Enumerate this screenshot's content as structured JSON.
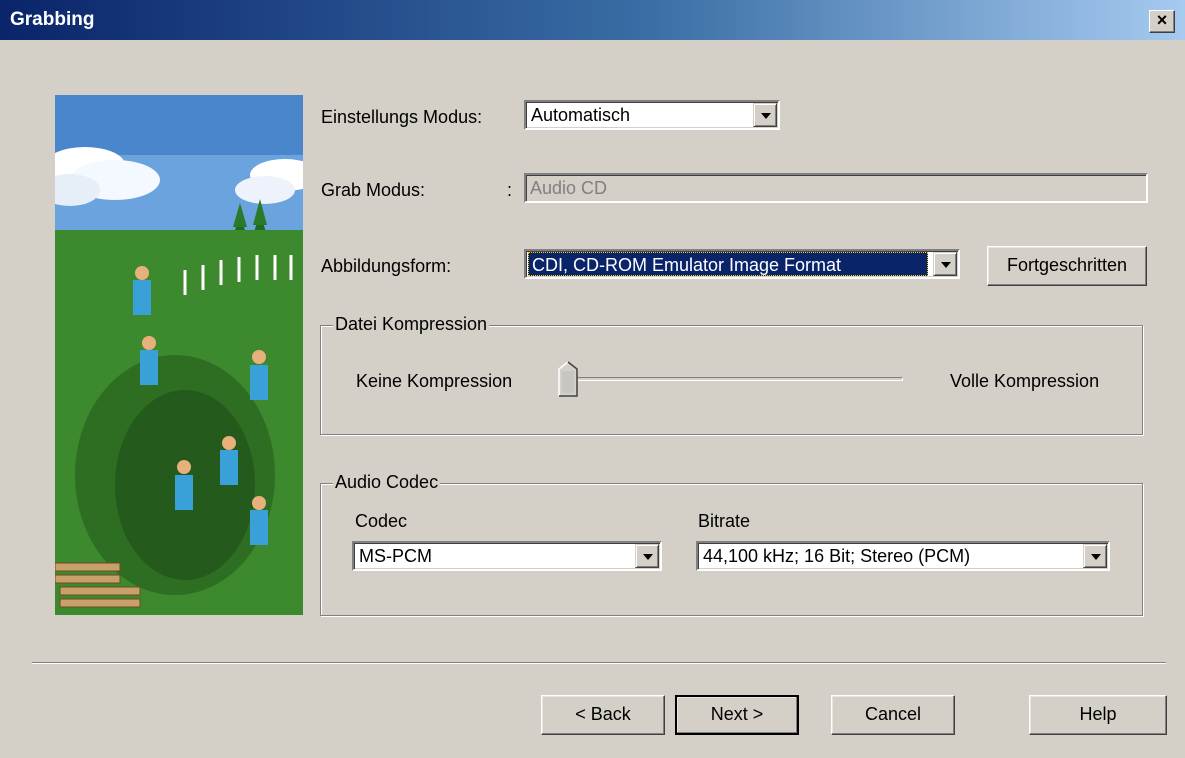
{
  "window": {
    "title": "Grabbing",
    "close_label": "×"
  },
  "form": {
    "settings_mode": {
      "label": "Einstellungs Modus:",
      "value": "Automatisch"
    },
    "grab_mode": {
      "label": "Grab Modus:",
      "colon": ":",
      "value": "Audio CD"
    },
    "image_format": {
      "label": "Abbildungsform:",
      "value": "CDI, CD-ROM Emulator Image Format"
    },
    "advanced_button": "Fortgeschritten"
  },
  "compression": {
    "legend": "Datei Kompression",
    "min_label": "Keine Kompression",
    "max_label": "Volle Kompression",
    "level": 0
  },
  "audio_codec": {
    "legend": "Audio Codec",
    "codec_label": "Codec",
    "codec_value": "MS-PCM",
    "bitrate_label": "Bitrate",
    "bitrate_value": "44,100 kHz; 16 Bit; Stereo (PCM)"
  },
  "buttons": {
    "back": "< Back",
    "next": "Next >",
    "cancel": "Cancel",
    "help": "Help"
  },
  "colors": {
    "title_start": "#0a246a",
    "title_end": "#a6caf0",
    "face": "#d4d0c8",
    "selection": "#0a246a"
  }
}
